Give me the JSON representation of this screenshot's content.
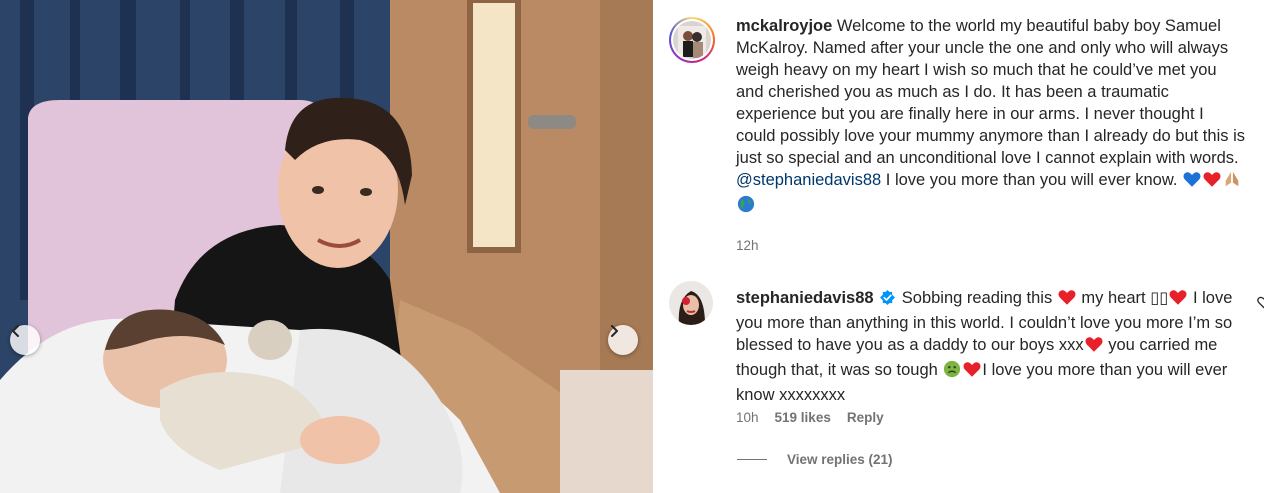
{
  "post": {
    "carousel": {
      "prev_icon": "chevron-left-icon",
      "next_icon": "chevron-right-icon"
    }
  },
  "caption": {
    "username": "mckalroyjoe",
    "text_1": "Welcome to the world my beautiful baby boy Samuel McKalroy. Named after your uncle the one and only who will always weigh heavy on my heart I wish so much that he could’ve met you and cherished you as much as I do. It has been a traumatic experience but you are finally here in our arms. I never thought I could possibly love your mummy anymore than I already do but this is just so special and an unconditional love I cannot explain with words.",
    "mention": "@stephaniedavis88",
    "text_2": "I love you more than you will ever know.",
    "emojis": [
      "blue-heart-emoji",
      "red-heart-emoji",
      "folded-hands-emoji",
      "globe-emoji"
    ],
    "time": "12h"
  },
  "comment": {
    "username": "stephaniedavis88",
    "verified": true,
    "text_1": "Sobbing reading this",
    "text_2": "my heart",
    "broken_chars": "▯▯",
    "text_3": "I love you more than anything in this world. I couldn’t love you more I’m so blessed to have you as a daddy to our boys xxx",
    "text_4": "you carried me though that, it was so tough",
    "text_5": "I love you more than you will ever know xxxxxxxx",
    "time": "10h",
    "likes": "519 likes",
    "reply_label": "Reply",
    "view_replies": "View replies (21)"
  },
  "colors": {
    "text": "#262626",
    "secondary": "#737373",
    "mention": "#00376b",
    "verified": "#0095f6",
    "heart": "#e8202a"
  }
}
